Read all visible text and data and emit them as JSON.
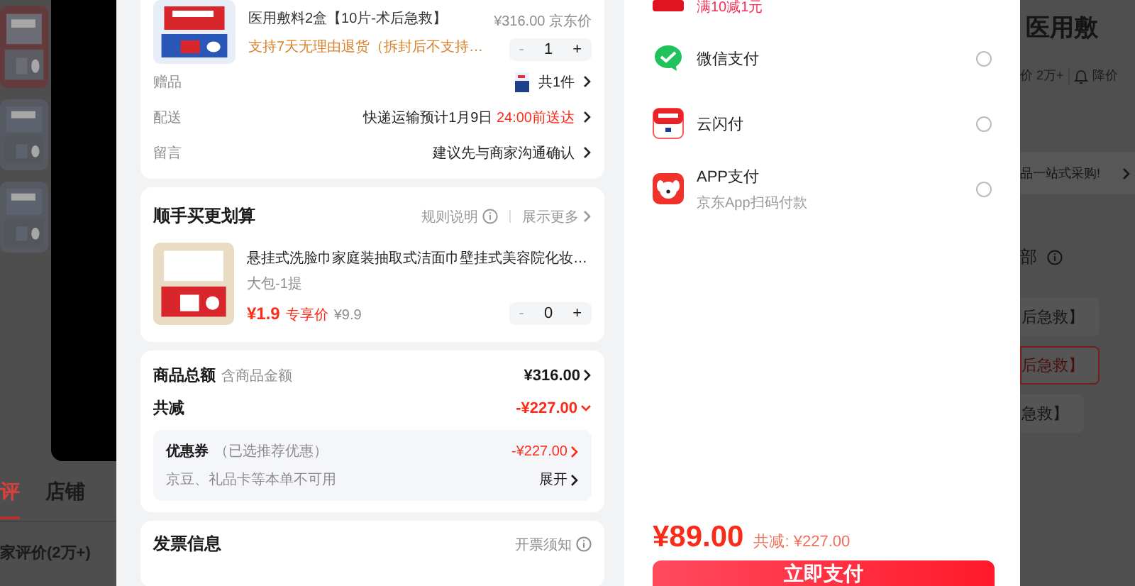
{
  "background_page": {
    "left": {
      "tabs": [
        {
          "label": "评",
          "selected": true
        },
        {
          "label": "店铺",
          "selected": false
        }
      ],
      "review_heading": "家评价(2万+)"
    },
    "right": {
      "title": "医用敷",
      "review_count": "价 2万+",
      "price_alert": "降价",
      "banner": "品一站式采购!",
      "section_label": "部",
      "options": [
        {
          "label": "后急救】",
          "selected": false
        },
        {
          "label": "后急救】",
          "selected": true
        },
        {
          "label": "急救】",
          "selected": false
        }
      ]
    }
  },
  "order": {
    "product": {
      "name": "医用敷料2盒【10片-术后急救】",
      "return_policy": "支持7天无理由退货（拆封后不支持…",
      "price": "¥316.00",
      "price_label": "京东价",
      "quantity": "1",
      "minus": "-",
      "plus": "+"
    },
    "rows": [
      {
        "label": "赠品",
        "value": "共1件",
        "kind": "gift"
      },
      {
        "label": "配送",
        "value": "快递运输预计1月9日",
        "highlight": "24:00前送达",
        "kind": "text"
      },
      {
        "label": "留言",
        "value": "建议先与商家沟通确认",
        "kind": "text"
      }
    ]
  },
  "addon": {
    "title": "顺手买更划算",
    "rules": "规则说明",
    "more": "展示更多",
    "product": {
      "name": "悬挂式洗脸巾家庭装抽取式洁面巾壁挂式美容院化妆…",
      "variant": "大包-1提",
      "price": "¥1.9",
      "price_label": "专享价",
      "original_price": "¥9.9",
      "quantity": "0",
      "minus": "-",
      "plus": "+"
    }
  },
  "summary": {
    "goods_total": {
      "label": "商品总额",
      "note": "含商品金额",
      "value": "¥316.00"
    },
    "discount": {
      "label": "共减",
      "value": "-¥227.00"
    },
    "coupon": {
      "label": "优惠券",
      "note": "（已选推荐优惠）",
      "value": "-¥227.00"
    },
    "unavailable": {
      "text": "京豆、礼品卡等本单不可用",
      "action": "展开"
    }
  },
  "invoice": {
    "title": "发票信息",
    "notice": "开票须知"
  },
  "payment": {
    "promo": "满10减1元",
    "methods": [
      {
        "name": "微信支付",
        "kind": "wechat",
        "selected": false
      },
      {
        "name": "云闪付",
        "kind": "unionpay",
        "selected": false
      },
      {
        "name": "APP支付",
        "note": "京东App扫码付款",
        "kind": "app",
        "selected": false
      }
    ],
    "total": "¥89.00",
    "saved": "共减: ¥227.00",
    "pay_button": "立即支付"
  }
}
